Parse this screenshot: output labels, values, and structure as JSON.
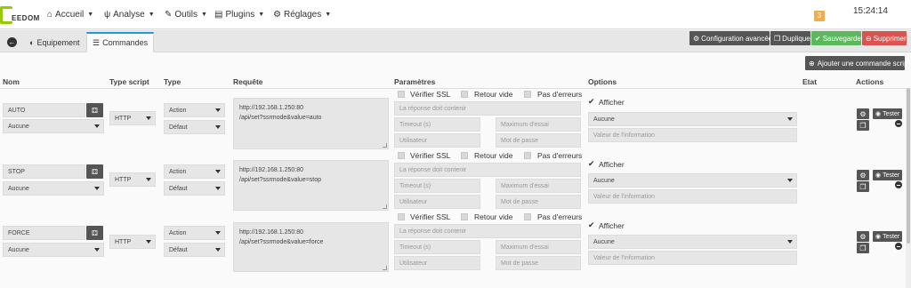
{
  "brand": {
    "logo_text": "EEDOM"
  },
  "nav": [
    {
      "icon": "⌂",
      "label": "Accueil"
    },
    {
      "icon": "ψ",
      "label": "Analyse"
    },
    {
      "icon": "✎",
      "label": "Outils"
    },
    {
      "icon": "▤",
      "label": "Plugins"
    },
    {
      "icon": "⚙",
      "label": "Réglages"
    }
  ],
  "notifications": {
    "count": "3"
  },
  "clock": "15:24:14",
  "tabs": {
    "back_icon": "←",
    "equipement": "Equipement",
    "commandes": "Commandes"
  },
  "actions": {
    "config": "Configuration avancée",
    "dupliquer": "Dupliquer",
    "sauvegarder": "Sauvegarder",
    "supprimer": "Supprimer",
    "ajouter": "Ajouter une commande script"
  },
  "columns": {
    "nom": "Nom",
    "type_script": "Type script",
    "type": "Type",
    "requete": "Requête",
    "parametres": "Paramètres",
    "options": "Options",
    "etat": "Etat",
    "actions": "Actions"
  },
  "params": {
    "verifier_ssl": "Vérifier SSL",
    "retour_vide": "Retour vide",
    "pas_erreurs": "Pas d'erreurs",
    "reponse_placeholder": "La réponse doit contenir",
    "timeout_placeholder": "Timeout (s)",
    "max_essai_placeholder": "Maximum d'essai",
    "utilisateur_placeholder": "Utilisateur",
    "mot_de_passe_placeholder": "Mot de passe"
  },
  "options_labels": {
    "afficher": "Afficher",
    "valeur_placeholder": "Valeur de l'information"
  },
  "tester_label": "Tester",
  "commands": [
    {
      "name": "AUTO",
      "sub": "Aucune",
      "script_type": "HTTP",
      "type": "Action",
      "subtype": "Défaut",
      "request_line1": "http://192.168.1.250:80",
      "request_line2": "/api/set?ssrmode&value=auto",
      "option_select": "Aucune"
    },
    {
      "name": "STOP",
      "sub": "Aucune",
      "script_type": "HTTP",
      "type": "Action",
      "subtype": "Défaut",
      "request_line1": "http://192.168.1.250:80",
      "request_line2": "/api/set?ssrmode&value=stop",
      "option_select": "Aucune"
    },
    {
      "name": "FORCE",
      "sub": "Aucune",
      "script_type": "HTTP",
      "type": "Action",
      "subtype": "Défaut",
      "request_line1": "http://192.168.1.250:80",
      "request_line2": "/api/set?ssrmode&value=force",
      "option_select": "Aucune"
    }
  ],
  "colors": {
    "accent": "#1c9dd6",
    "logo_green": "#93ca02",
    "success": "#5cb85c",
    "danger": "#d9534f",
    "dark_button": "#555555",
    "badge": "#f0ad4e"
  }
}
